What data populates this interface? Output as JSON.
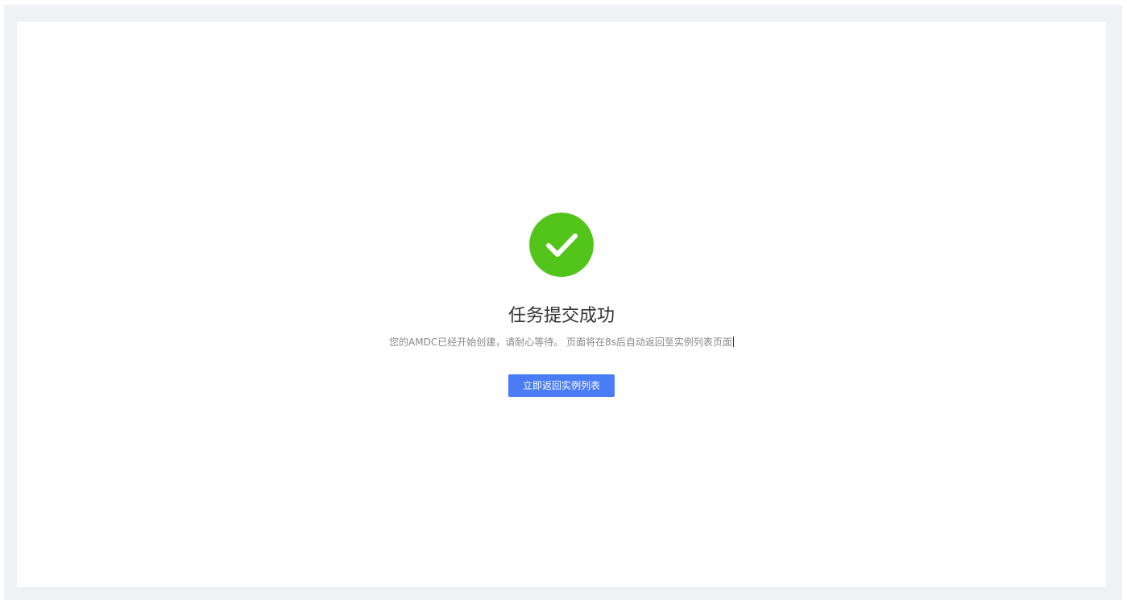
{
  "colors": {
    "page_bg": "#eff1f5",
    "card_bg": "#ffffff",
    "success": "#52c41a",
    "primary": "#4a7cf6",
    "title_text": "#333333",
    "desc_text": "#888888"
  },
  "result": {
    "icon": "check-circle-icon",
    "title": "任务提交成功",
    "description": "您的AMDC已经开始创建，请耐心等待。 页面将在8s后自动返回至实例列表页面",
    "button_label": "立即返回实例列表"
  }
}
